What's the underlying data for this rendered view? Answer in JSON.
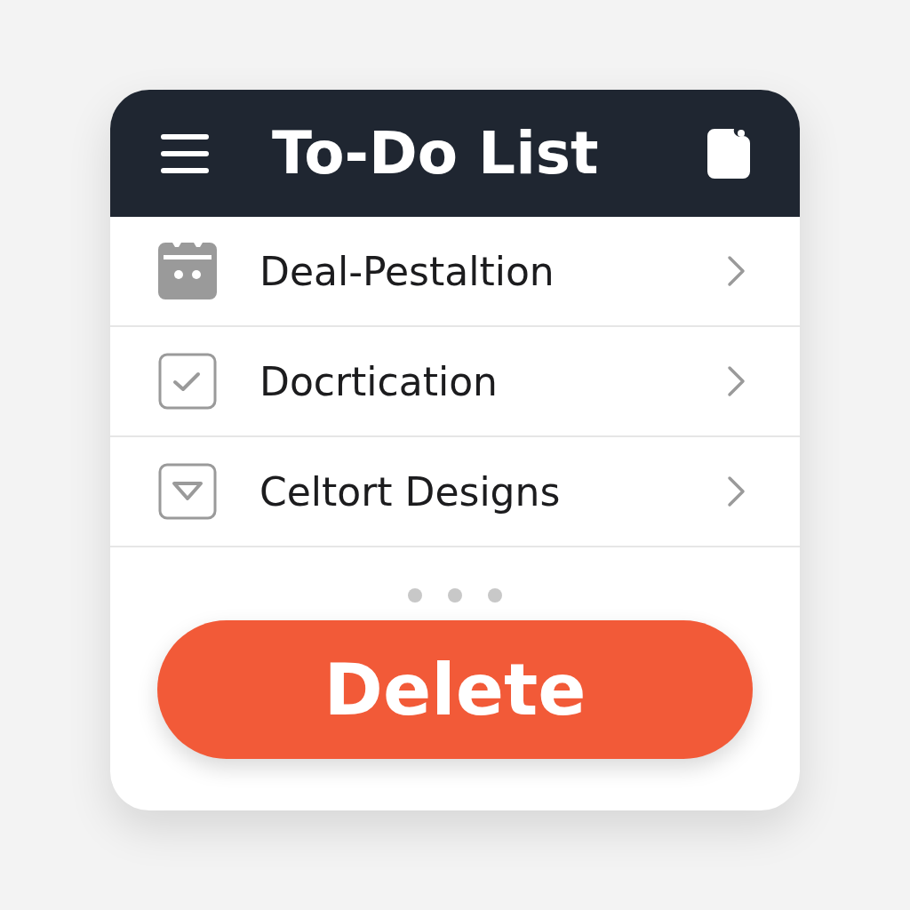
{
  "header": {
    "title": "To-Do List"
  },
  "items": [
    {
      "label": "Deal-Pestaltion",
      "kind": "calendar"
    },
    {
      "label": "Docrtication",
      "kind": "check"
    },
    {
      "label": "Celtort Designs",
      "kind": "triangle"
    }
  ],
  "button": {
    "label": "Delete"
  }
}
